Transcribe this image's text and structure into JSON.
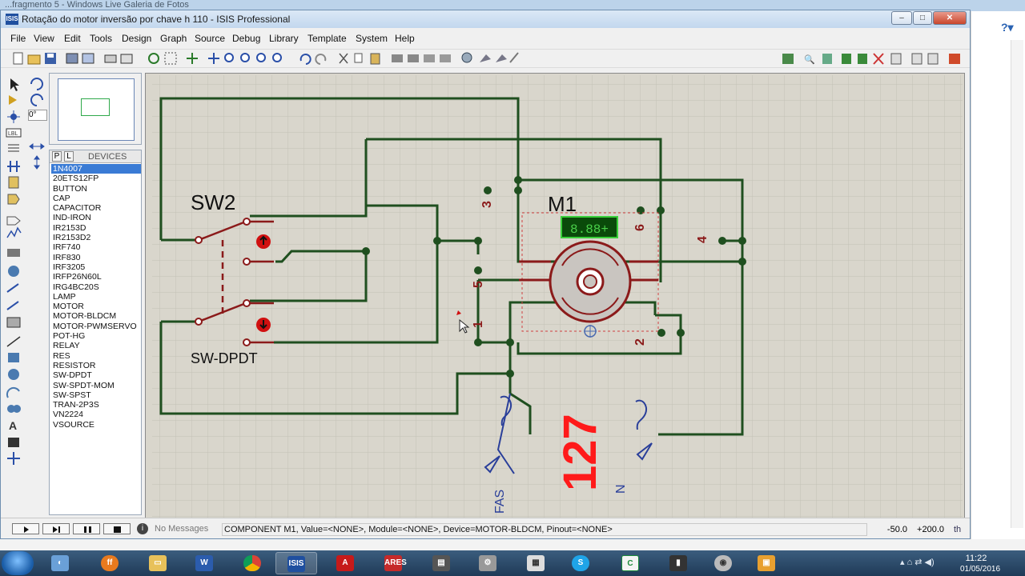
{
  "background_window": {
    "title": "...fragmento 5 - Windows Live Galeria de Fotos",
    "help_icon": "help-icon"
  },
  "window": {
    "title": "Rotação do motor inversão por chave h 110 - ISIS Professional",
    "app_icon": "ISIS",
    "minimize": "–",
    "maximize": "□",
    "close": "✕"
  },
  "menu": [
    "File",
    "View",
    "Edit",
    "Tools",
    "Design",
    "Graph",
    "Source",
    "Debug",
    "Library",
    "Template",
    "System",
    "Help"
  ],
  "rotation_value": "0°",
  "devices": {
    "tab_p": "P",
    "tab_l": "L",
    "title": "DEVICES",
    "selected_index": 0,
    "items": [
      "1N4007",
      "20ETS12FP",
      "BUTTON",
      "CAP",
      "CAPACITOR",
      "IND-IRON",
      "IR2153D",
      "IR2153D2",
      "IRF740",
      "IRF830",
      "IRF3205",
      "IRFP26N60L",
      "IRG4BC20S",
      "LAMP",
      "MOTOR",
      "MOTOR-BLDCM",
      "MOTOR-PWMSERVO",
      "POT-HG",
      "RELAY",
      "RES",
      "RESISTOR",
      "SW-DPDT",
      "SW-SPDT-MOM",
      "SW-SPST",
      "TRAN-2P3S",
      "VN2224",
      "VSOURCE"
    ]
  },
  "schematic": {
    "switch_label": "SW2",
    "switch_type": "SW-DPDT",
    "motor_label": "M1",
    "motor_display": "8.88+",
    "pins": [
      "3",
      "6",
      "4",
      "5",
      "1",
      "2"
    ],
    "voltage": "127",
    "terminal_left": "FAS",
    "terminal_right": "N",
    "colors": {
      "wire": "#1f4f1f",
      "component": "#8b1a1a",
      "voltage_text": "#ff1a1a",
      "terminal_text": "#2a3f9a",
      "grid_bg": "#d9d6cc"
    }
  },
  "status": {
    "message_icon": "info-icon",
    "messages": "No Messages",
    "component_info": "COMPONENT M1, Value=<NONE>, Module=<NONE>, Device=MOTOR-BLDCM, Pinout=<NONE>",
    "coord_x": "-50.0",
    "coord_y": "+200.0",
    "unit": "th"
  },
  "taskbar": {
    "apps": [
      "windows-explorer",
      "firefox",
      "file-explorer",
      "word",
      "chrome",
      "isis",
      "acrobat",
      "ares",
      "app-window",
      "app-tool",
      "calculator",
      "skype",
      "app-c",
      "app-device",
      "app-disk",
      "app-screen"
    ],
    "time": "11:22",
    "date": "01/05/2016"
  }
}
